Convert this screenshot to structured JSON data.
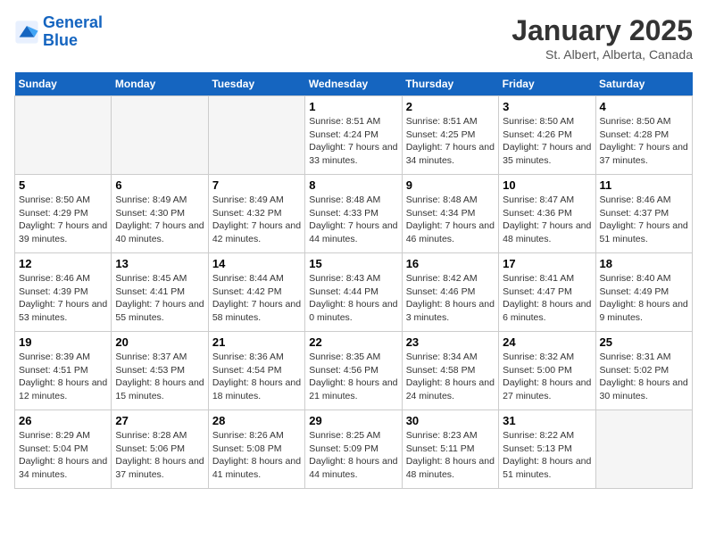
{
  "logo": {
    "line1": "General",
    "line2": "Blue"
  },
  "title": "January 2025",
  "subtitle": "St. Albert, Alberta, Canada",
  "weekdays": [
    "Sunday",
    "Monday",
    "Tuesday",
    "Wednesday",
    "Thursday",
    "Friday",
    "Saturday"
  ],
  "weeks": [
    [
      {
        "day": "",
        "detail": ""
      },
      {
        "day": "",
        "detail": ""
      },
      {
        "day": "",
        "detail": ""
      },
      {
        "day": "1",
        "detail": "Sunrise: 8:51 AM\nSunset: 4:24 PM\nDaylight: 7 hours and 33 minutes."
      },
      {
        "day": "2",
        "detail": "Sunrise: 8:51 AM\nSunset: 4:25 PM\nDaylight: 7 hours and 34 minutes."
      },
      {
        "day": "3",
        "detail": "Sunrise: 8:50 AM\nSunset: 4:26 PM\nDaylight: 7 hours and 35 minutes."
      },
      {
        "day": "4",
        "detail": "Sunrise: 8:50 AM\nSunset: 4:28 PM\nDaylight: 7 hours and 37 minutes."
      }
    ],
    [
      {
        "day": "5",
        "detail": "Sunrise: 8:50 AM\nSunset: 4:29 PM\nDaylight: 7 hours and 39 minutes."
      },
      {
        "day": "6",
        "detail": "Sunrise: 8:49 AM\nSunset: 4:30 PM\nDaylight: 7 hours and 40 minutes."
      },
      {
        "day": "7",
        "detail": "Sunrise: 8:49 AM\nSunset: 4:32 PM\nDaylight: 7 hours and 42 minutes."
      },
      {
        "day": "8",
        "detail": "Sunrise: 8:48 AM\nSunset: 4:33 PM\nDaylight: 7 hours and 44 minutes."
      },
      {
        "day": "9",
        "detail": "Sunrise: 8:48 AM\nSunset: 4:34 PM\nDaylight: 7 hours and 46 minutes."
      },
      {
        "day": "10",
        "detail": "Sunrise: 8:47 AM\nSunset: 4:36 PM\nDaylight: 7 hours and 48 minutes."
      },
      {
        "day": "11",
        "detail": "Sunrise: 8:46 AM\nSunset: 4:37 PM\nDaylight: 7 hours and 51 minutes."
      }
    ],
    [
      {
        "day": "12",
        "detail": "Sunrise: 8:46 AM\nSunset: 4:39 PM\nDaylight: 7 hours and 53 minutes."
      },
      {
        "day": "13",
        "detail": "Sunrise: 8:45 AM\nSunset: 4:41 PM\nDaylight: 7 hours and 55 minutes."
      },
      {
        "day": "14",
        "detail": "Sunrise: 8:44 AM\nSunset: 4:42 PM\nDaylight: 7 hours and 58 minutes."
      },
      {
        "day": "15",
        "detail": "Sunrise: 8:43 AM\nSunset: 4:44 PM\nDaylight: 8 hours and 0 minutes."
      },
      {
        "day": "16",
        "detail": "Sunrise: 8:42 AM\nSunset: 4:46 PM\nDaylight: 8 hours and 3 minutes."
      },
      {
        "day": "17",
        "detail": "Sunrise: 8:41 AM\nSunset: 4:47 PM\nDaylight: 8 hours and 6 minutes."
      },
      {
        "day": "18",
        "detail": "Sunrise: 8:40 AM\nSunset: 4:49 PM\nDaylight: 8 hours and 9 minutes."
      }
    ],
    [
      {
        "day": "19",
        "detail": "Sunrise: 8:39 AM\nSunset: 4:51 PM\nDaylight: 8 hours and 12 minutes."
      },
      {
        "day": "20",
        "detail": "Sunrise: 8:37 AM\nSunset: 4:53 PM\nDaylight: 8 hours and 15 minutes."
      },
      {
        "day": "21",
        "detail": "Sunrise: 8:36 AM\nSunset: 4:54 PM\nDaylight: 8 hours and 18 minutes."
      },
      {
        "day": "22",
        "detail": "Sunrise: 8:35 AM\nSunset: 4:56 PM\nDaylight: 8 hours and 21 minutes."
      },
      {
        "day": "23",
        "detail": "Sunrise: 8:34 AM\nSunset: 4:58 PM\nDaylight: 8 hours and 24 minutes."
      },
      {
        "day": "24",
        "detail": "Sunrise: 8:32 AM\nSunset: 5:00 PM\nDaylight: 8 hours and 27 minutes."
      },
      {
        "day": "25",
        "detail": "Sunrise: 8:31 AM\nSunset: 5:02 PM\nDaylight: 8 hours and 30 minutes."
      }
    ],
    [
      {
        "day": "26",
        "detail": "Sunrise: 8:29 AM\nSunset: 5:04 PM\nDaylight: 8 hours and 34 minutes."
      },
      {
        "day": "27",
        "detail": "Sunrise: 8:28 AM\nSunset: 5:06 PM\nDaylight: 8 hours and 37 minutes."
      },
      {
        "day": "28",
        "detail": "Sunrise: 8:26 AM\nSunset: 5:08 PM\nDaylight: 8 hours and 41 minutes."
      },
      {
        "day": "29",
        "detail": "Sunrise: 8:25 AM\nSunset: 5:09 PM\nDaylight: 8 hours and 44 minutes."
      },
      {
        "day": "30",
        "detail": "Sunrise: 8:23 AM\nSunset: 5:11 PM\nDaylight: 8 hours and 48 minutes."
      },
      {
        "day": "31",
        "detail": "Sunrise: 8:22 AM\nSunset: 5:13 PM\nDaylight: 8 hours and 51 minutes."
      },
      {
        "day": "",
        "detail": ""
      }
    ]
  ]
}
